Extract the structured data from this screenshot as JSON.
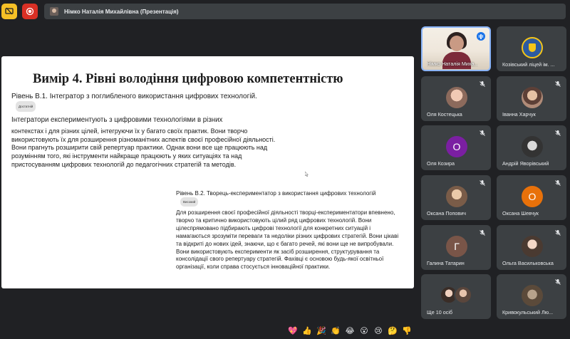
{
  "top_bar": {
    "presenter_label": "Німко Наталія Михайлівна (Презентація)"
  },
  "slide": {
    "title": "Вимір 4. Рівні володіння цифровою компетентністю",
    "section1": {
      "heading": "Рівень В.1. Інтегратор з поглибленого використання цифрових технологій.",
      "badge": "Достатній",
      "first_line": "Інтегратори експериментують з цифровими технологіями в різних",
      "body": "контекстах і для різних цілей, інтегруючи їх у багато своїх практик. Вони творчо використовують їх для розширення різноманітних аспектів своєї професійної діяльності. Вони прагнуть розширити свій репертуар практики. Однак вони все ще працюють над розумінням того, які інструменти найкраще працюють у яких ситуаціях та над пристосуванням цифрових технологій до педагогічних стратегій та методів."
    },
    "section2": {
      "heading": "Рівень В.2. Творець-експериментатор з використання цифрових технологій",
      "badge": "Високий",
      "body": "Для розширення своєї професійної діяльності творці-експериментатори впевнено, творчо та критично використовують цілий ряд цифрових технологій. Вони цілеспрямовано підбирають цифрові технології для конкретних ситуацій і намагаються зрозуміти переваги та недоліки різних цифрових стратегій. Вони цікаві та відкриті до нових ідей, знаючи, що є багато речей, які вони ще не випробували. Вони використовують експерименти як засіб розширення, структурування та консолідації свого репертуару стратегій. Фахівці є основою будь-якої освітньої організації, коли справа стосується інноваційної практики."
    }
  },
  "participants": {
    "self": {
      "name": "Німко Наталія Миха..."
    },
    "tiles": [
      {
        "name": "Козівський ліцей ім. ..."
      },
      {
        "name": "Оля Костецька"
      },
      {
        "name": "Іванна Харчук"
      },
      {
        "name": "Оля Козира",
        "initial": "О"
      },
      {
        "name": "Андрій Яворівський"
      },
      {
        "name": "Оксана Попович"
      },
      {
        "name": "Оксана Шевчук",
        "initial": "О"
      },
      {
        "name": "Галина Татарин",
        "initial": "Г"
      },
      {
        "name": "Ольга Васильковська"
      },
      {
        "name": "Ще 10 осіб"
      },
      {
        "name": "Кривокульський Лю..."
      }
    ]
  },
  "reactions": [
    "💖",
    "👍",
    "🎉",
    "👏",
    "😂",
    "😮",
    "😢",
    "🤔",
    "👎"
  ],
  "icons": {
    "top_left": "stop-presenting-icon",
    "top_red": "record-icon",
    "mic": "mic-off-icon"
  },
  "colors": {
    "background": "#202124",
    "tile": "#3c4043",
    "accent_yellow": "#f6c026",
    "accent_red": "#d93025",
    "speaking_blue": "#1a73e8"
  }
}
